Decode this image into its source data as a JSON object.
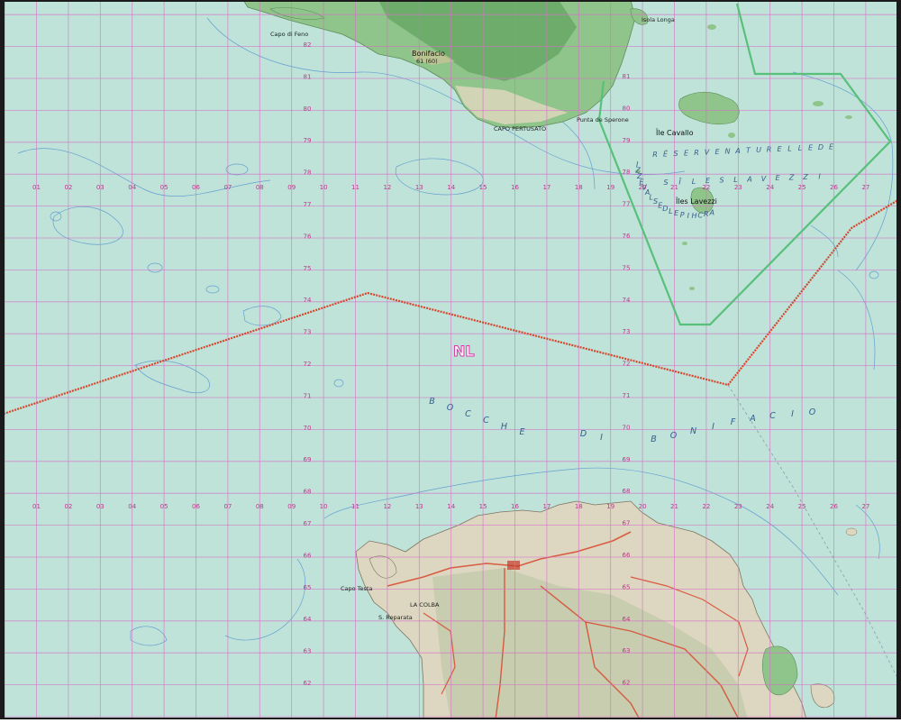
{
  "map": {
    "colors": {
      "sea": "#bfe3d8",
      "land_green": "#79b97a",
      "land_light": "#d9d6c4",
      "grid": "#d86fc7",
      "boundary_red": "#d8452c",
      "reserve_green": "#58c07a"
    },
    "grid_labels": {
      "columns": [
        "01",
        "02",
        "03",
        "04",
        "05",
        "06",
        "07",
        "08",
        "09",
        "10",
        "11",
        "12",
        "13",
        "14",
        "15",
        "16",
        "17",
        "18",
        "19",
        "20",
        "21",
        "22",
        "23",
        "24",
        "25",
        "26",
        "27"
      ],
      "rows_upper": [
        "82",
        "81",
        "80",
        "79",
        "78",
        "77",
        "76",
        "75",
        "74",
        "73",
        "72",
        "71",
        "70",
        "69",
        "68"
      ],
      "rows_lower": [
        "67",
        "66",
        "65",
        "64",
        "63",
        "62"
      ],
      "rows_right": [
        "81",
        "80",
        "79",
        "78",
        "77",
        "76",
        "75",
        "74",
        "73",
        "72",
        "71",
        "70",
        "69",
        "68",
        "67",
        "66",
        "65",
        "64",
        "63",
        "62"
      ]
    },
    "labels": {
      "nl": "NL",
      "sea_words": [
        "B",
        "O",
        "C",
        "C",
        "H",
        "E",
        "D",
        "I",
        "B",
        "O",
        "N",
        "I",
        "F",
        "A",
        "C",
        "I",
        "O"
      ],
      "reserve_words": [
        "R",
        "É",
        "S",
        "E",
        "R",
        "V",
        "E",
        "N",
        "A",
        "T",
        "U",
        "R",
        "E",
        "L",
        "L",
        "E",
        "D",
        "E",
        "S",
        "Î",
        "L",
        "E",
        "S",
        "L",
        "A",
        "V",
        "E",
        "Z",
        "Z",
        "I"
      ],
      "archipel": [
        "A",
        "R",
        "C",
        "H",
        "I",
        "P",
        "E",
        "L",
        "D",
        "E",
        "S",
        "L",
        "A",
        "V",
        "E",
        "Z",
        "Z",
        "I"
      ],
      "capo_di_feno": "Capo di Feno",
      "bonifacio": "Bonifacio",
      "bonifacio_alt": "61 (60)",
      "capo_pertusato": "CAPO PERTUSATO",
      "punta_sperone": "Punta de Sperone",
      "ile_cavallo": "Île Cavallo",
      "iles_lavezzi": "Îles Lavezzi",
      "capo_testa": "Capo Testa",
      "s_reparata": "S. Reparata",
      "isola_longa": "Isola Longa",
      "la_colba": "LA COLBA"
    }
  }
}
